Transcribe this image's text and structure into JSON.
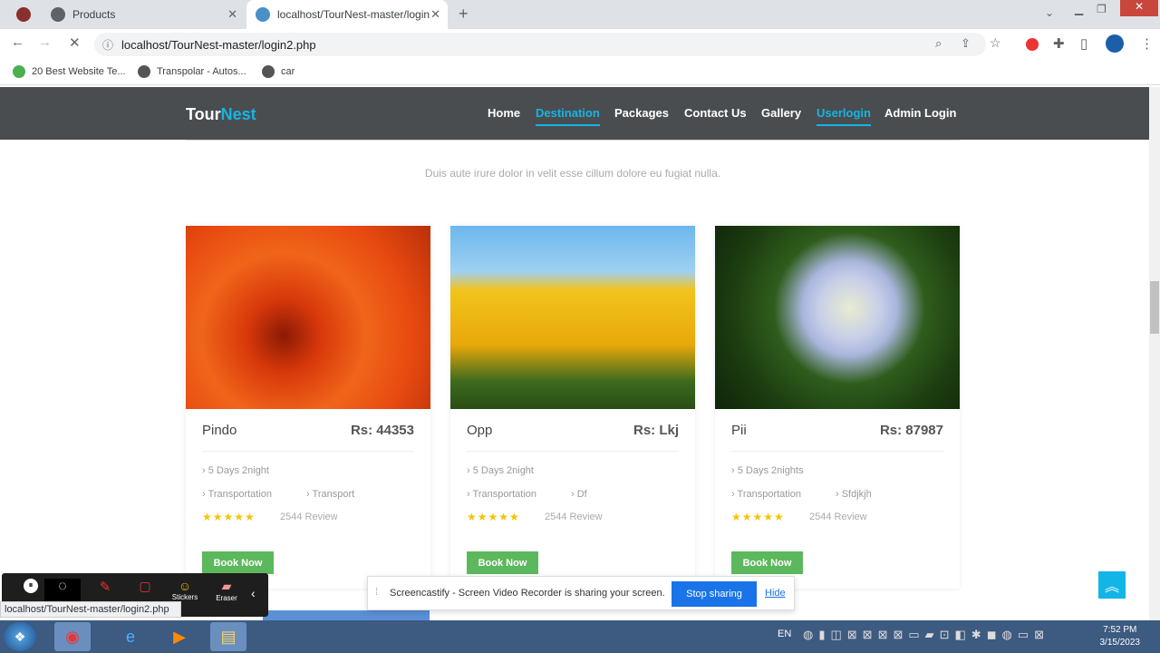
{
  "browser": {
    "tabs": [
      {
        "label": "Products"
      },
      {
        "label": "localhost/TourNest-master/login"
      }
    ],
    "url": "localhost/TourNest-master/login2.php",
    "bookmarks": [
      "20 Best Website Te...",
      "Transpolar - Autos...",
      "car"
    ]
  },
  "site": {
    "logo_part1": "Tour",
    "logo_part2": "Nest",
    "nav": [
      "Home",
      "Destination",
      "Packages",
      "Contact Us",
      "Gallery",
      "Userlogin",
      "Admin Login"
    ],
    "subtitle": "Duis aute irure dolor in velit esse cillum dolore eu fugiat nulla.",
    "cards": [
      {
        "name": "Pindo",
        "price": "Rs: 44353",
        "duration": "› 5 Days 2night",
        "transport": "› Transportation",
        "extra": "› Transport",
        "reviews": "2544 Review",
        "button": "Book Now"
      },
      {
        "name": "Opp",
        "price": "Rs: Lkj",
        "duration": "› 5 Days 2night",
        "transport": "› Transportation",
        "extra": "› Df",
        "reviews": "2544 Review",
        "button": "Book Now"
      },
      {
        "name": "Pii",
        "price": "Rs: 87987",
        "duration": "› 5 Days 2nights",
        "transport": "› Transportation",
        "extra": "› Sfdjkjh",
        "reviews": "2544 Review",
        "button": "Book Now"
      }
    ],
    "stars": "★★★★★"
  },
  "recorder": {
    "tools": [
      "",
      "",
      "",
      "",
      "Stickers",
      "Eraser"
    ],
    "status_url": "localhost/TourNest-master/login2.php"
  },
  "share_bar": {
    "message": "Screencastify - Screen Video Recorder is sharing your screen.",
    "stop": "Stop sharing",
    "hide": "Hide"
  },
  "taskbar": {
    "lang": "EN",
    "time": "7:52 PM",
    "date": "3/15/2023"
  },
  "colors": {
    "accent": "#13b5e6",
    "nav_bg": "#4a4d50",
    "button": "#5cb85c"
  }
}
